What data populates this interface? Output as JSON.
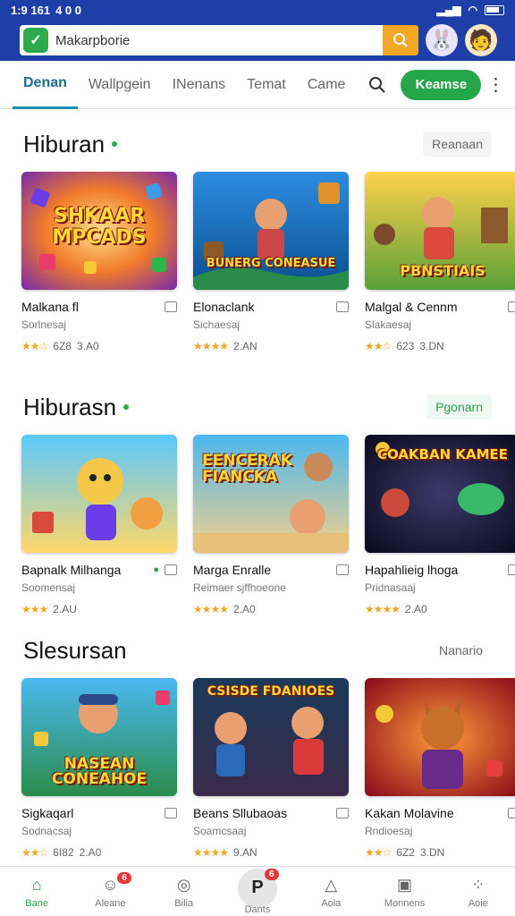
{
  "status_bar": {
    "time": "1:9 161",
    "icons": "4 0 0"
  },
  "header": {
    "search_placeholder": "Makarpborie",
    "colors": {
      "bar": "#1f3fa8",
      "search_button": "#f5a623",
      "logo": "#2eaa4e"
    }
  },
  "tabs": {
    "items": [
      {
        "label": "Denan",
        "active": true
      },
      {
        "label": "Wallpgein"
      },
      {
        "label": "INenans"
      },
      {
        "label": "Temat"
      },
      {
        "label": "Came"
      }
    ],
    "cta_label": "Keamse"
  },
  "sections": [
    {
      "title": "Hiburan",
      "link": "Reanaan",
      "cards": [
        {
          "art": "SHKAAR MPCADS",
          "name": "Malkana fl",
          "sub": "Sorlnesaj",
          "rating_text": "6Z8",
          "count": "3.A0",
          "stars": 2
        },
        {
          "art": "BUNERG CONEASUE",
          "name": "Elonaclank",
          "sub": "Sichaesaj",
          "rating_text": "",
          "count": "2.AN",
          "stars": 4
        },
        {
          "art": "PBNSTIAIS",
          "name": "Malgal & Cennm",
          "sub": "Slakaesaj",
          "rating_text": "623",
          "count": "3.DN",
          "stars": 2
        }
      ]
    },
    {
      "title": "Hiburasn",
      "link": "Pgonarn",
      "cards": [
        {
          "art": "",
          "name": "Bapnalk Milhanga",
          "sub": "Soomensaj",
          "rating_text": "",
          "count": "2.AU",
          "stars": 3
        },
        {
          "art": "EENCERAK FIANCKA",
          "name": "Marga Enralle",
          "sub": "Reimaer sjffhoeone",
          "rating_text": "",
          "count": "2.A0",
          "stars": 4
        },
        {
          "art": "COAKBAN KAMEE",
          "name": "Hapahlieig lhoga",
          "sub": "Pridnasaaj",
          "rating_text": "",
          "count": "2.A0",
          "stars": 4
        }
      ]
    },
    {
      "title": "Slesursan",
      "link": "Nanario",
      "cards": [
        {
          "art": "NASEAN CONEAHOE",
          "name": "Sigkaqarl",
          "sub": "Sodnacsaj",
          "rating_text": "6I82",
          "count": "2.A0",
          "stars": 2
        },
        {
          "art": "CSISDE FDANIOES",
          "name": "Beans Sllubaoas",
          "sub": "Soamcsaaj",
          "rating_text": "",
          "count": "9.AN",
          "stars": 4
        },
        {
          "art": "",
          "name": "Kakan Molavine",
          "sub": "Rndioesaj",
          "rating_text": "6Z2",
          "count": "3.DN",
          "stars": 2
        }
      ]
    }
  ],
  "bottom_nav": [
    {
      "label": "Bane",
      "icon": "home-icon",
      "active": true
    },
    {
      "label": "Aleane",
      "icon": "user-icon",
      "badge": "6"
    },
    {
      "label": "Bilia",
      "icon": "compass-icon"
    },
    {
      "label": "Dants",
      "icon": "p-icon",
      "badge": "6",
      "center": true
    },
    {
      "label": "Aola",
      "icon": "tent-icon"
    },
    {
      "label": "Monnens",
      "icon": "calendar-icon"
    },
    {
      "label": "Aoie",
      "icon": "apps-icon"
    }
  ]
}
